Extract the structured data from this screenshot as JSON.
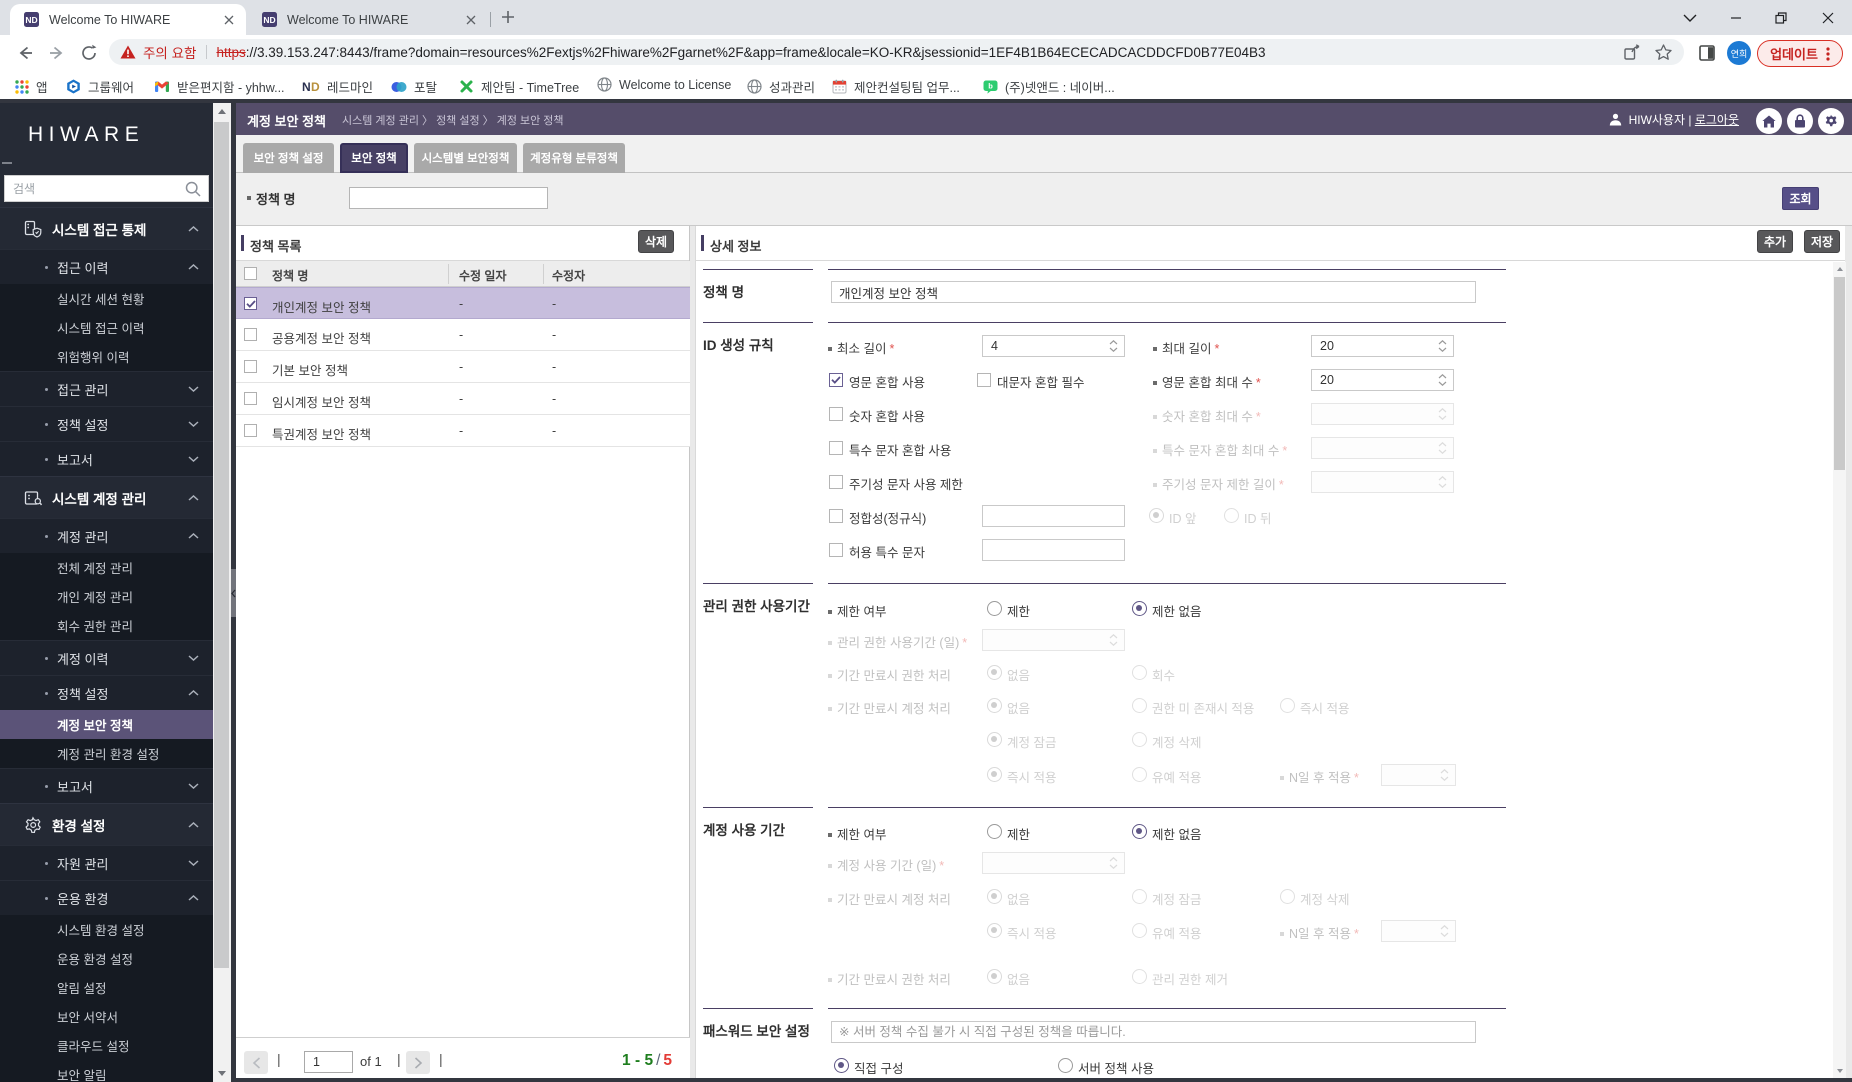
{
  "browser": {
    "favicon": "ND",
    "tabs": [
      {
        "title": "Welcome To HIWARE"
      },
      {
        "title": "Welcome To HIWARE"
      }
    ],
    "address": {
      "warning": "주의 요함",
      "scheme": "https",
      "url_rest": "://3.39.153.247:8443/frame?domain=resources%2Fextjs%2Fhiware%2Fgarnet%2F&app=frame&locale=KO-KR&jsessionid=1EF4B1B64ECECADCACDDCFD0B77E04B3"
    },
    "profile": "연희",
    "update_label": "업데이트",
    "apps_label": "앱",
    "bookmarks": [
      {
        "label": "그룹웨어"
      },
      {
        "label": "받은편지함 - yhhw..."
      },
      {
        "label": "레드마인"
      },
      {
        "label": "포탈"
      },
      {
        "label": "제안팀 - TimeTree"
      },
      {
        "label": "Welcome to License"
      },
      {
        "label": "성과관리"
      },
      {
        "label": "제안컨설팅팀 업무..."
      },
      {
        "label": "(주)넷앤드 : 네이버..."
      }
    ]
  },
  "sidebar": {
    "logo": "HIWARE",
    "search_placeholder": "검색",
    "menu": [
      {
        "type": "main",
        "label": "시스템 접근 통제",
        "icon": "access-control",
        "chevron": "up"
      },
      {
        "type": "sub",
        "label": "접근 이력",
        "chevron": "up"
      },
      {
        "type": "leaf",
        "label": "실시간 세션 현황"
      },
      {
        "type": "leaf",
        "label": "시스템 접근 이력"
      },
      {
        "type": "leaf",
        "label": "위험행위 이력"
      },
      {
        "type": "sub",
        "label": "접근 관리",
        "chevron": "down"
      },
      {
        "type": "sub",
        "label": "정책 설정",
        "chevron": "down"
      },
      {
        "type": "sub",
        "label": "보고서",
        "chevron": "down"
      },
      {
        "type": "main",
        "label": "시스템 계정 관리",
        "icon": "account-management",
        "chevron": "up"
      },
      {
        "type": "sub",
        "label": "계정 관리",
        "chevron": "up"
      },
      {
        "type": "leaf",
        "label": "전체 계정 관리"
      },
      {
        "type": "leaf",
        "label": "개인 계정 관리"
      },
      {
        "type": "leaf",
        "label": "회수 권한 관리"
      },
      {
        "type": "sub",
        "label": "계정 이력",
        "chevron": "down"
      },
      {
        "type": "sub",
        "label": "정책 설정",
        "chevron": "up"
      },
      {
        "type": "leaf",
        "label": "계정 보안 정책",
        "selected": true
      },
      {
        "type": "leaf",
        "label": "계정 관리 환경 설정"
      },
      {
        "type": "sub",
        "label": "보고서",
        "chevron": "down"
      },
      {
        "type": "main",
        "label": "환경 설정",
        "icon": "settings",
        "chevron": "up"
      },
      {
        "type": "sub",
        "label": "자원 관리",
        "chevron": "down"
      },
      {
        "type": "sub",
        "label": "운용 환경",
        "chevron": "up"
      },
      {
        "type": "leaf",
        "label": "시스템 환경 설정"
      },
      {
        "type": "leaf",
        "label": "운용 환경 설정"
      },
      {
        "type": "leaf",
        "label": "알림 설정"
      },
      {
        "type": "leaf",
        "label": "보안 서약서"
      },
      {
        "type": "leaf",
        "label": "클라우드 설정"
      },
      {
        "type": "leaf",
        "label": "보안 알림"
      }
    ]
  },
  "header": {
    "title": "계정 보안 정책",
    "breadcrumb": "시스템 계정 관리 〉 정책 설정 〉 계정 보안 정책",
    "user": "HIW사용자",
    "divider": "|",
    "logout": "로그아웃"
  },
  "tabs": [
    {
      "label": "보안 정책 설정",
      "active": false
    },
    {
      "label": "보안 정책",
      "active": true
    },
    {
      "label": "시스템별 보안정책",
      "active": false
    },
    {
      "label": "계정유형 분류정책",
      "active": false
    }
  ],
  "filter": {
    "label": "정책 명",
    "value": "",
    "search_button": "조회"
  },
  "list": {
    "title": "정책 목록",
    "delete_button": "삭제",
    "columns": [
      "정책 명",
      "수정 일자",
      "수정자"
    ],
    "rows": [
      {
        "name": "개인계정 보안 정책",
        "modified": "-",
        "editor": "-",
        "checked": true,
        "selected": true
      },
      {
        "name": "공용계정 보안 정책",
        "modified": "-",
        "editor": "-",
        "checked": false,
        "selected": false
      },
      {
        "name": "기본 보안 정책",
        "modified": "-",
        "editor": "-",
        "checked": false,
        "selected": false
      },
      {
        "name": "임시계정 보안 정책",
        "modified": "-",
        "editor": "-",
        "checked": false,
        "selected": false
      },
      {
        "name": "특권계정 보안 정책",
        "modified": "-",
        "editor": "-",
        "checked": false,
        "selected": false
      }
    ],
    "pagination": {
      "page": "1",
      "of_label": "of 1",
      "sep": "|",
      "range": "1 - 5",
      "slash": "/",
      "total": "5"
    }
  },
  "detail": {
    "title": "상세 정보",
    "add_button": "추가",
    "save_button": "저장",
    "required_mark": "*",
    "policy_name": {
      "label": "정책 명",
      "value": "개인계정 보안 정책"
    },
    "id_rules": {
      "label": "ID 생성 규칙",
      "min_length": {
        "label": "최소 길이",
        "value": "4"
      },
      "max_length": {
        "label": "최대 길이",
        "value": "20"
      },
      "eng_mix": {
        "label": "영문 혼합 사용",
        "checked": true
      },
      "upper_required": {
        "label": "대문자 혼합 필수",
        "checked": false
      },
      "eng_max": {
        "label": "영문 혼합 최대 수",
        "value": "20"
      },
      "num_mix": {
        "label": "숫자 혼합 사용",
        "checked": false
      },
      "num_max": {
        "label": "숫자 혼합 최대 수",
        "value": ""
      },
      "special_mix": {
        "label": "특수 문자 혼합 사용",
        "checked": false
      },
      "special_max": {
        "label": "특수 문자 혼합 최대 수",
        "value": ""
      },
      "periodic_mix": {
        "label": "주기성 문자 사용 제한",
        "checked": false
      },
      "periodic_len": {
        "label": "주기성 문자 제한 길이",
        "value": ""
      },
      "regex": {
        "label": "정합성(정규식)",
        "value": ""
      },
      "id_front": "ID 앞",
      "id_back": "ID 뒤",
      "allowed_special": {
        "label": "허용 특수 문자",
        "value": ""
      }
    },
    "admin_period": {
      "label": "관리 권한 사용기간",
      "limit_yn": "제한 여부",
      "limit": "제한",
      "no_limit": "제한 없음",
      "days": "관리 권한 사용기간 (일)",
      "expire_perm": "기간 만료시 권한 처리",
      "none1": "없음",
      "revoke": "회수",
      "expire_account": "기간 만료시 계정 처리",
      "none2": "없음",
      "no_perm_apply": "권한 미 존재시 적용",
      "immediate1": "즉시 적용",
      "lock": "계정 잠금",
      "delete": "계정 삭제",
      "immediate2": "즉시 적용",
      "defer": "유예 적용",
      "n_days": "N일 후 적용"
    },
    "account_period": {
      "label": "계정 사용 기간",
      "limit_yn": "제한 여부",
      "limit": "제한",
      "no_limit": "제한 없음",
      "days": "계정 사용 기간 (일)",
      "expire_account": "기간 만료시 계정 처리",
      "none1": "없음",
      "lock": "계정 잠금",
      "delete": "계정 삭제",
      "immediate": "즉시 적용",
      "defer": "유예 적용",
      "n_days": "N일 후 적용",
      "expire_perm": "기간 만료시 권한 처리",
      "none2": "없음",
      "remove_admin": "관리 권한 제거"
    },
    "password": {
      "label": "패스워드 보안 설정",
      "note": "※ 서버 정책 수집 불가 시 직접 구성된 정책을 따릅니다.",
      "direct": "직접 구성",
      "server": "서버 정책 사용"
    }
  }
}
